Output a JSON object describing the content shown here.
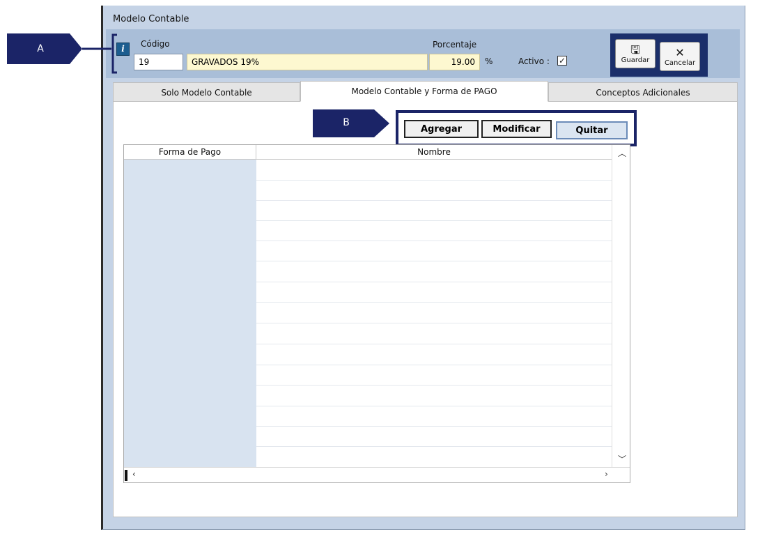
{
  "window": {
    "title": "Modelo Contable"
  },
  "header": {
    "codigo_label": "Código",
    "codigo_value": "19",
    "descripcion_value": "GRAVADOS 19%",
    "porcentaje_label": "Porcentaje",
    "porcentaje_value": "19.00",
    "percent_sign": "%",
    "activo_label": "Activo :",
    "activo_checked": true
  },
  "toolbar": {
    "guardar_label": "Guardar",
    "cancelar_label": "Cancelar"
  },
  "tabs": [
    {
      "label": "Solo Modelo Contable",
      "active": false
    },
    {
      "label": "Modelo Contable y Forma de PAGO",
      "active": true
    },
    {
      "label": "Conceptos Adicionales",
      "active": false
    }
  ],
  "actions": {
    "agregar": "Agregar",
    "modificar": "Modificar",
    "quitar": "Quitar"
  },
  "grid": {
    "columns": [
      "Forma de Pago",
      "Nombre"
    ],
    "rows": []
  },
  "callouts": {
    "a": "A",
    "b": "B"
  },
  "colors": {
    "callout": "#1b2467",
    "header": "#a9bed8",
    "window": "#c5d3e6",
    "first_column": "#d8e3f0"
  }
}
